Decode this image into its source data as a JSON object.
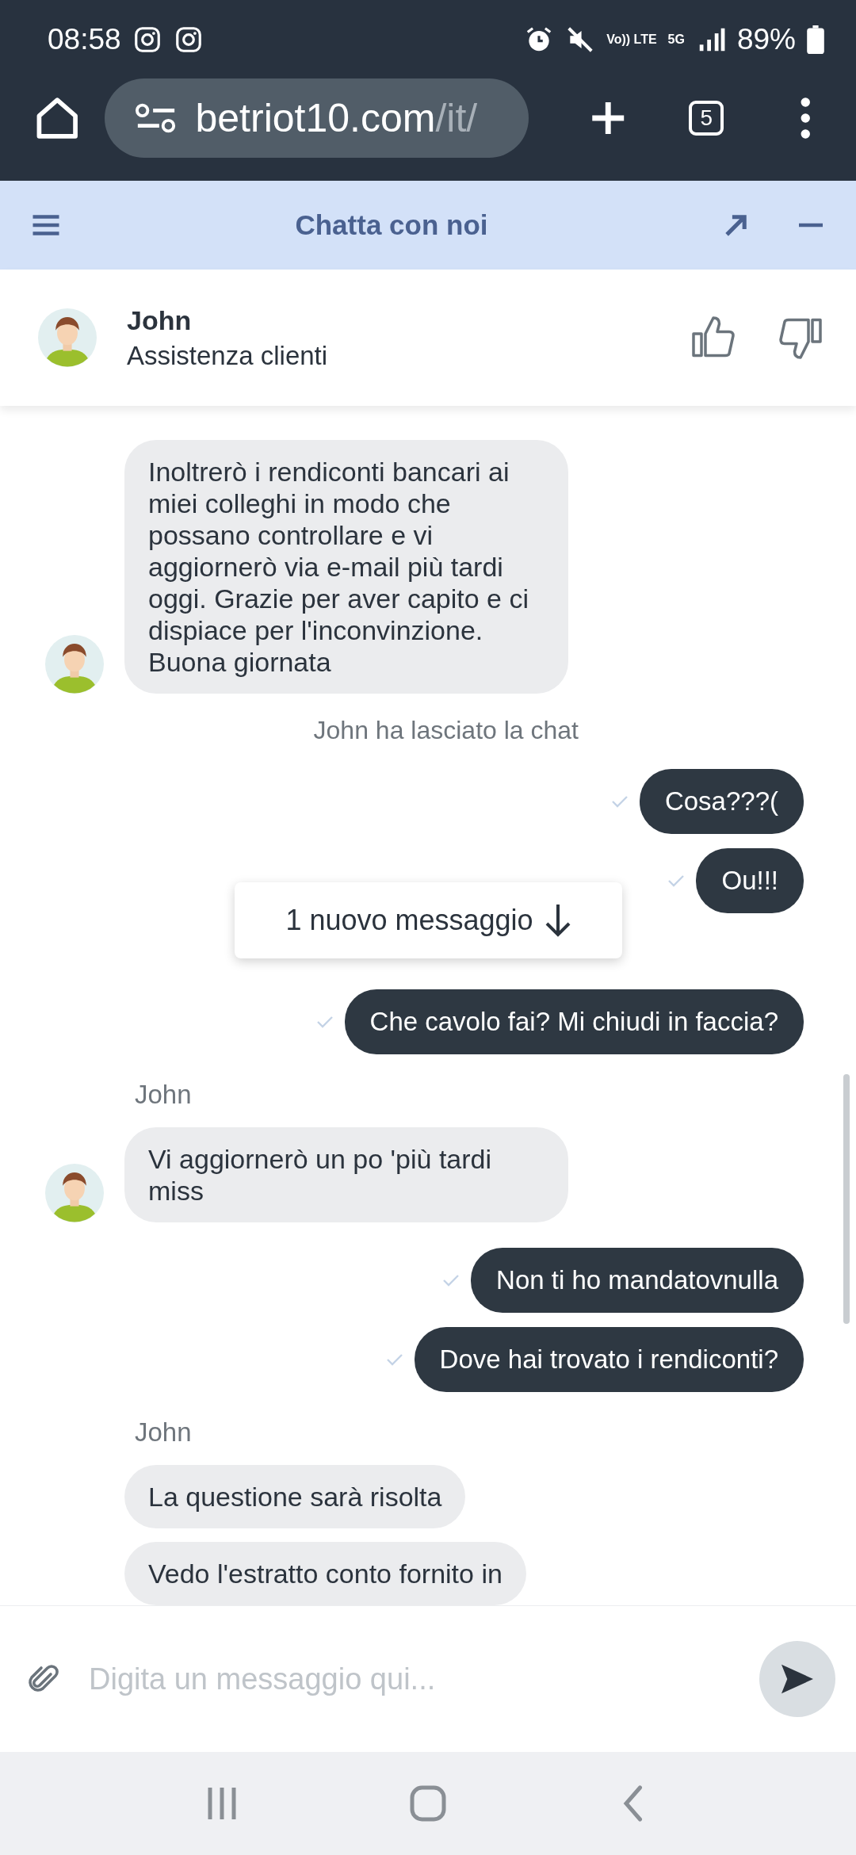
{
  "status_bar": {
    "time": "08:58",
    "volte_label": "Vo)) LTE",
    "network_label": "5G",
    "battery": "89%"
  },
  "browser": {
    "url_host": "betriot10.com",
    "url_path": "/it/",
    "tab_count": "5"
  },
  "chat_header": {
    "title": "Chatta con noi"
  },
  "agent": {
    "name": "John",
    "role": "Assistenza clienti"
  },
  "messages": [
    {
      "kind": "agent",
      "avatar": true,
      "text": "Inoltrerò i rendiconti bancari ai miei colleghi in modo che possano controllare e vi aggiornerò via e-mail più tardi oggi. Grazie per aver capito e ci dispiace per l'inconvinzione. Buona giornata"
    },
    {
      "kind": "system",
      "text": "John ha lasciato la chat"
    },
    {
      "kind": "user",
      "delivered": true,
      "text": "Cosa???("
    },
    {
      "kind": "user",
      "delivered": true,
      "text": "Ou!!!"
    },
    {
      "kind": "notice",
      "text": "1 nuovo messaggio"
    },
    {
      "kind": "user",
      "delivered": true,
      "text": "Che cavolo fai? Mi chiudi in faccia?"
    },
    {
      "kind": "sender",
      "text": "John"
    },
    {
      "kind": "agent",
      "avatar": true,
      "text": "Vi aggiornerò un po 'più tardi miss"
    },
    {
      "kind": "user",
      "delivered": true,
      "text": "Non ti ho mandatovnulla"
    },
    {
      "kind": "user",
      "delivered": true,
      "text": "Dove hai trovato i rendiconti?"
    },
    {
      "kind": "sender",
      "text": "John"
    },
    {
      "kind": "agent",
      "avatar": false,
      "text": "La questione sarà risolta"
    },
    {
      "kind": "agent",
      "avatar": false,
      "text": "Vedo l'estratto conto fornito in"
    }
  ],
  "composer": {
    "placeholder": "Digita un messaggio qui..."
  }
}
